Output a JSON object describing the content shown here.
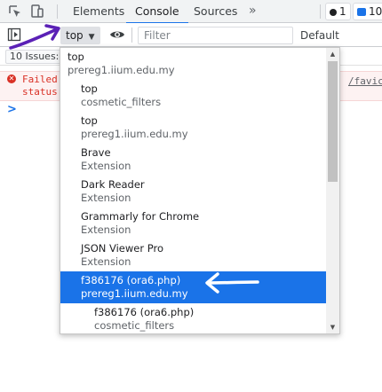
{
  "tabs": {
    "elements": "Elements",
    "console": "Console",
    "sources": "Sources",
    "more": "»",
    "issues_count": "1",
    "messages_count": "10"
  },
  "toolbar": {
    "context": "top",
    "filter_placeholder": "Filter",
    "levels": "Default levels"
  },
  "issues": {
    "label": "10 Issues:"
  },
  "console": {
    "error_line1": "Failed",
    "error_line2": "status",
    "error_link": "/favic",
    "prompt": ">"
  },
  "context_menu": {
    "items": [
      {
        "name": "top",
        "origin": "prereg1.iium.edu.my",
        "indent": 0
      },
      {
        "name": "top",
        "origin": "cosmetic_filters",
        "indent": 1
      },
      {
        "name": "top",
        "origin": "prereg1.iium.edu.my",
        "indent": 1
      },
      {
        "name": "Brave",
        "origin": "Extension",
        "indent": 1
      },
      {
        "name": "Dark Reader",
        "origin": "Extension",
        "indent": 1
      },
      {
        "name": "Grammarly for Chrome",
        "origin": "Extension",
        "indent": 1
      },
      {
        "name": "JSON Viewer Pro",
        "origin": "Extension",
        "indent": 1
      },
      {
        "name": "f386176 (ora6.php)",
        "origin": "prereg1.iium.edu.my",
        "indent": 1,
        "selected": true
      },
      {
        "name": "f386176 (ora6.php)",
        "origin": "cosmetic_filters",
        "indent": 2
      }
    ]
  },
  "colors": {
    "accent": "#1a73e8",
    "error": "#d93025",
    "annotation_arrow": "#5b21b6"
  }
}
